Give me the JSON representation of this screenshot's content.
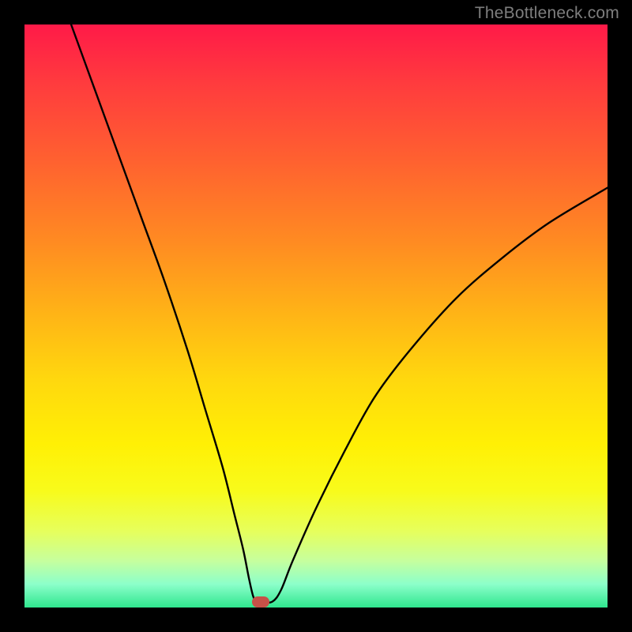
{
  "watermark": "TheBottleneck.com",
  "chart_data": {
    "type": "line",
    "title": "",
    "xlabel": "",
    "ylabel": "",
    "xlim": [
      0,
      100
    ],
    "ylim": [
      0,
      100
    ],
    "series": [
      {
        "name": "bottleneck-curve",
        "x": [
          8,
          12,
          16,
          20,
          24,
          28,
          31,
          34,
          36,
          37.5,
          38.5,
          39.2,
          39.8,
          40.5,
          42.5,
          44,
          46,
          50,
          55,
          60,
          66,
          74,
          82,
          90,
          100
        ],
        "values": [
          100,
          89,
          78,
          67,
          56,
          44,
          34,
          24,
          16,
          10,
          5,
          2,
          0.9,
          0.9,
          1.0,
          3,
          8,
          17,
          27,
          36,
          44,
          53,
          60,
          66,
          72
        ]
      }
    ],
    "marker": {
      "x": 40.5,
      "y": 0.9,
      "color": "#c75148"
    },
    "gradient_stops": [
      {
        "pos": 0,
        "color": "#ff1a48"
      },
      {
        "pos": 50,
        "color": "#ffb516"
      },
      {
        "pos": 72,
        "color": "#fff005"
      },
      {
        "pos": 100,
        "color": "#2fe68e"
      }
    ]
  }
}
